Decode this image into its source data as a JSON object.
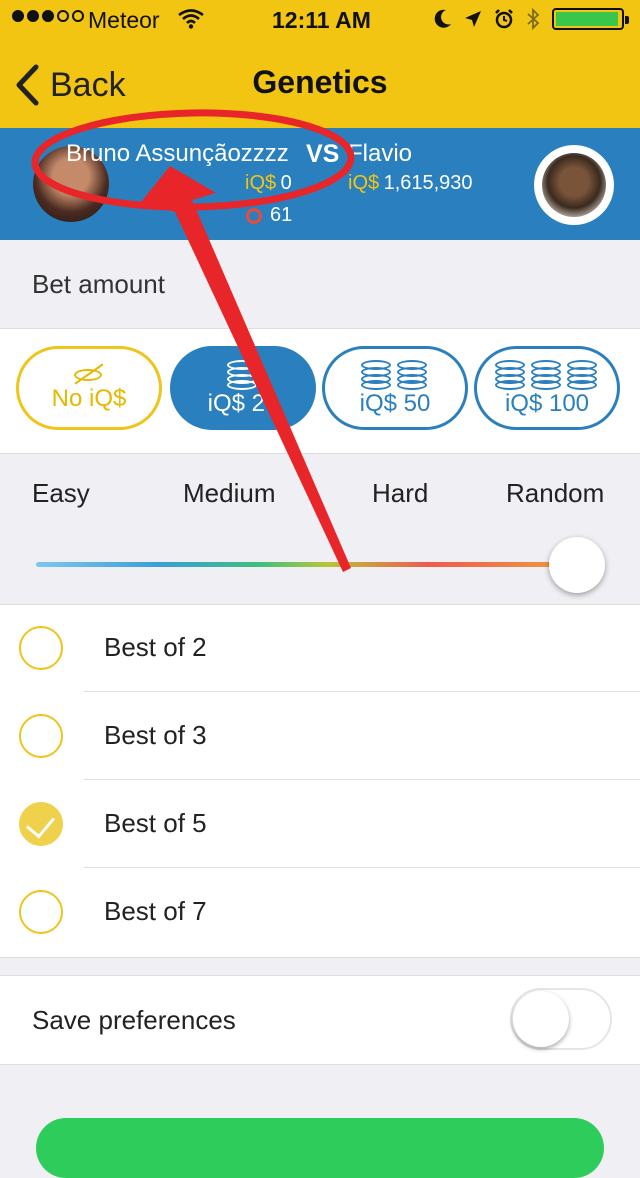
{
  "status_bar": {
    "carrier": "Meteor",
    "time": "12:11 AM",
    "signal_bars": 3,
    "signal_total": 5
  },
  "nav": {
    "back_label": "Back",
    "title": "Genetics"
  },
  "match": {
    "player_left": {
      "name": "Bruno Assunçãozzzz",
      "iq_label": "iQ$",
      "iq_value": "0",
      "points": "61"
    },
    "vs": "VS",
    "player_right": {
      "name": "Flavio",
      "iq_label": "iQ$",
      "iq_value": "1,615,930"
    }
  },
  "bet": {
    "section_label": "Bet amount",
    "options": [
      {
        "label": "No iQ$",
        "selected": false
      },
      {
        "label": "iQ$ 20",
        "selected": true
      },
      {
        "label": "iQ$ 50",
        "selected": false
      },
      {
        "label": "iQ$ 100",
        "selected": false
      }
    ]
  },
  "difficulty": {
    "levels": [
      "Easy",
      "Medium",
      "Hard",
      "Random"
    ],
    "selected": "Random"
  },
  "rounds": {
    "options": [
      {
        "label": "Best of 2",
        "checked": false
      },
      {
        "label": "Best of 3",
        "checked": false
      },
      {
        "label": "Best of 5",
        "checked": true
      },
      {
        "label": "Best of 7",
        "checked": false
      }
    ]
  },
  "preferences": {
    "save_label": "Save preferences",
    "save_enabled": false
  },
  "colors": {
    "nav_yellow": "#f2c512",
    "match_blue": "#2a7fbf",
    "radio_yellow": "#f0c419",
    "annotation_red": "#e8262a",
    "start_green": "#2ecc5a"
  }
}
